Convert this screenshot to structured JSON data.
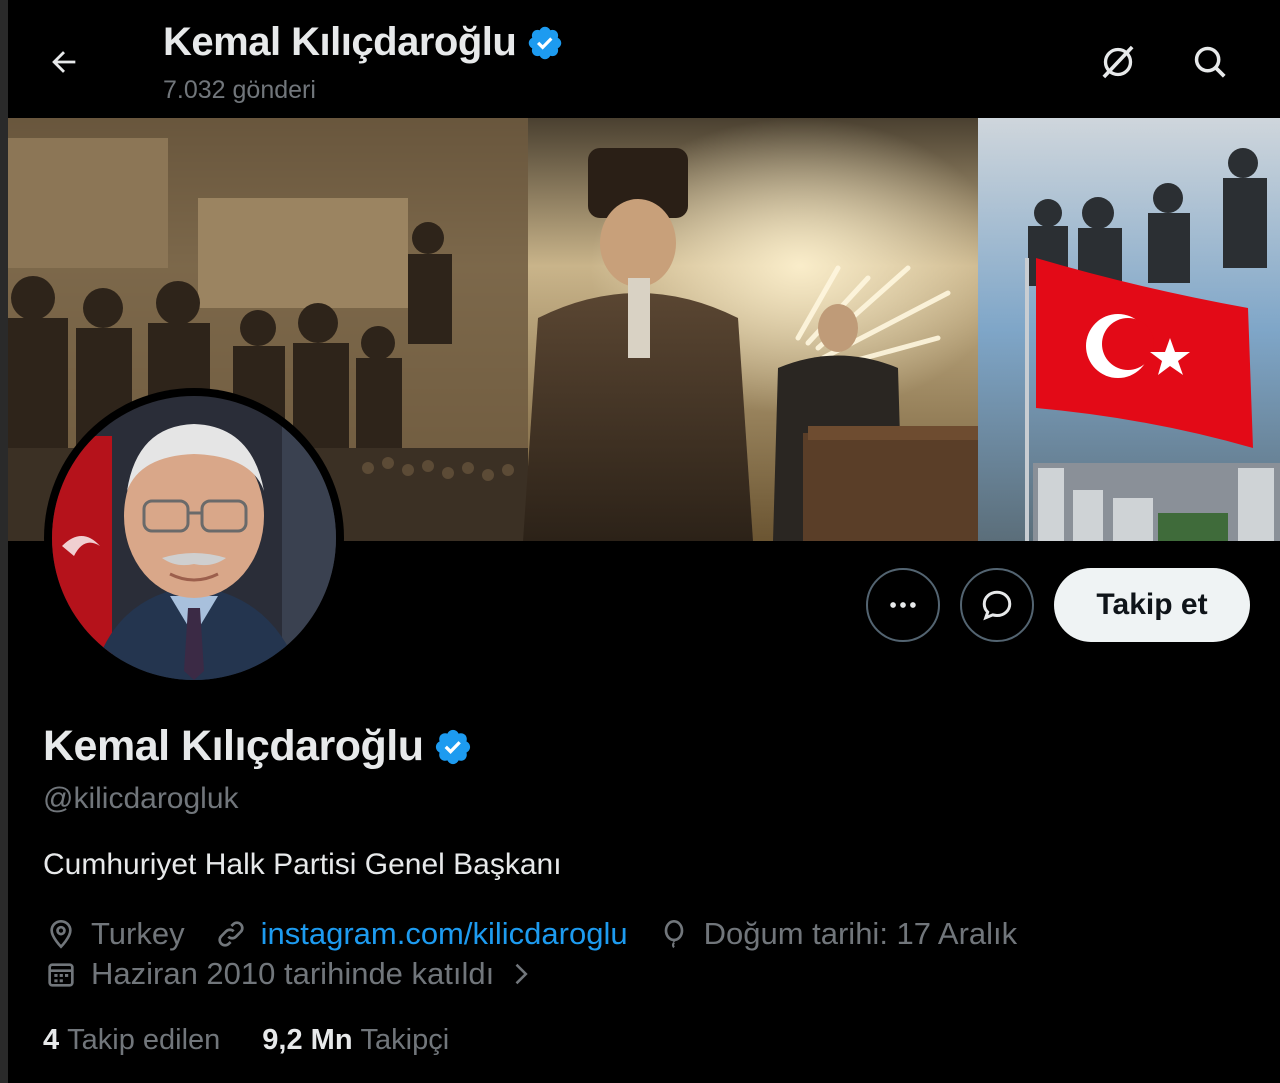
{
  "header": {
    "title": "Kemal Kılıçdaroğlu",
    "post_count": "7.032 gönderi"
  },
  "profile": {
    "name": "Kemal Kılıçdaroğlu",
    "handle": "@kilicdarogluk",
    "bio": "Cumhuriyet Halk Partisi Genel Başkanı",
    "location": "Turkey",
    "website": "instagram.com/kilicdaroglu",
    "birthday": "Doğum tarihi: 17 Aralık",
    "joined": "Haziran 2010 tarihinde katıldı",
    "following_count": "4",
    "following_label": "Takip edilen",
    "followers_count": "9,2 Mn",
    "followers_label": "Takipçi"
  },
  "actions": {
    "follow_label": "Takip et"
  },
  "icons": {
    "back": "arrow-left-icon",
    "grok": "grok-icon",
    "search": "search-icon",
    "verified": "verified-badge-icon",
    "more": "more-icon",
    "message": "message-icon",
    "location": "location-pin-icon",
    "link": "link-icon",
    "birthday": "balloon-icon",
    "calendar": "calendar-icon",
    "chevron": "chevron-right-icon"
  },
  "colors": {
    "accent": "#1d9bf0",
    "background": "#000000",
    "secondary_text": "#71767b",
    "verified": "#1d9bf0"
  }
}
